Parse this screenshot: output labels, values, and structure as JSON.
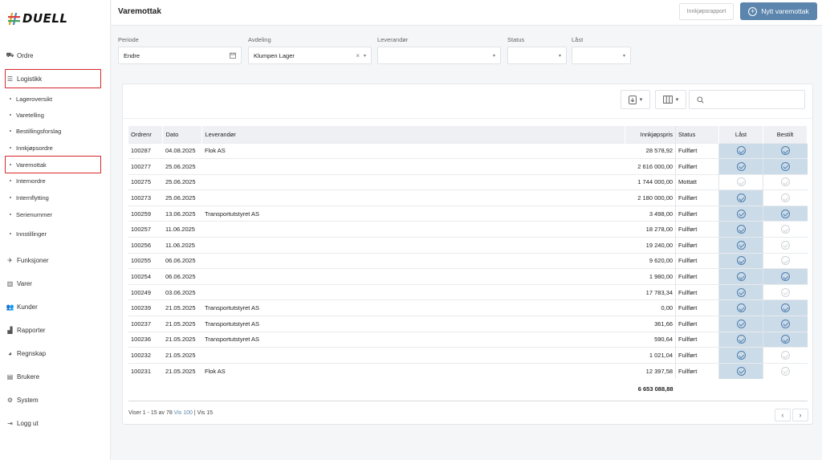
{
  "app": {
    "logo_text": "DUELL"
  },
  "sidebar": {
    "items": [
      {
        "name": "ordre",
        "label": "Ordre",
        "icon": "truck-icon"
      },
      {
        "name": "logistikk",
        "label": "Logistikk",
        "icon": "list-icon"
      },
      {
        "name": "funksjoner",
        "label": "Funksjoner",
        "icon": "rocket-icon"
      },
      {
        "name": "varer",
        "label": "Varer",
        "icon": "barcode-icon"
      },
      {
        "name": "kunder",
        "label": "Kunder",
        "icon": "users-icon"
      },
      {
        "name": "rapporter",
        "label": "Rapporter",
        "icon": "chart-icon"
      },
      {
        "name": "regnskap",
        "label": "Regnskap",
        "icon": "pie-icon"
      },
      {
        "name": "brukere",
        "label": "Brukere",
        "icon": "id-card-icon"
      },
      {
        "name": "system",
        "label": "System",
        "icon": "cogs-icon"
      },
      {
        "name": "logg-ut",
        "label": "Logg ut",
        "icon": "logout-icon"
      }
    ],
    "sub_items": [
      {
        "name": "lageroversikt",
        "label": "Lageroversikt"
      },
      {
        "name": "varetelling",
        "label": "Varetelling"
      },
      {
        "name": "bestillingsforslag",
        "label": "Bestillingsforslag"
      },
      {
        "name": "innkjopsordre",
        "label": "Innkjøpsordre"
      },
      {
        "name": "varemottak",
        "label": "Varemottak"
      },
      {
        "name": "internordre",
        "label": "Internordre"
      },
      {
        "name": "internflytting",
        "label": "Internflytting"
      },
      {
        "name": "serienummer",
        "label": "Serienummer"
      },
      {
        "name": "innstillinger",
        "label": "Innstillinger"
      }
    ],
    "highlight_color": "#d9252a"
  },
  "header": {
    "title": "Varemottak",
    "report_button": "Innkjøpsrapport",
    "new_button": "Nytt varemottak",
    "accent_color": "#5b85ad"
  },
  "filters": {
    "periode": {
      "label": "Periode",
      "value": "Endre"
    },
    "avdeling": {
      "label": "Avdeling",
      "value": "Klumpen Lager"
    },
    "leverandor": {
      "label": "Leverandør",
      "value": ""
    },
    "status": {
      "label": "Status",
      "value": ""
    },
    "last": {
      "label": "Låst",
      "value": ""
    }
  },
  "table": {
    "headers": {
      "ordrenr": "Ordrenr",
      "dato": "Dato",
      "leverandor": "Leverandør",
      "innkjopspris": "Innkjøpspris",
      "status": "Status",
      "last": "Låst",
      "bestilt": "Bestilt"
    },
    "rows": [
      {
        "ordrenr": "100287",
        "dato": "04.08.2025",
        "leverandor": "Flok AS",
        "innkjopspris": "28 578,92",
        "status": "Fullført",
        "last": true,
        "bestilt": true
      },
      {
        "ordrenr": "100277",
        "dato": "25.06.2025",
        "leverandor": "",
        "innkjopspris": "2 616 000,00",
        "status": "Fullført",
        "last": true,
        "bestilt": true
      },
      {
        "ordrenr": "100275",
        "dato": "25.06.2025",
        "leverandor": "",
        "innkjopspris": "1 744 000,00",
        "status": "Mottatt",
        "last": false,
        "bestilt": false
      },
      {
        "ordrenr": "100273",
        "dato": "25.06.2025",
        "leverandor": "",
        "innkjopspris": "2 180 000,00",
        "status": "Fullført",
        "last": true,
        "bestilt": false
      },
      {
        "ordrenr": "100259",
        "dato": "13.06.2025",
        "leverandor": "Transportutstyret AS",
        "innkjopspris": "3 498,00",
        "status": "Fullført",
        "last": true,
        "bestilt": true
      },
      {
        "ordrenr": "100257",
        "dato": "11.06.2025",
        "leverandor": "",
        "innkjopspris": "18 278,00",
        "status": "Fullført",
        "last": true,
        "bestilt": false
      },
      {
        "ordrenr": "100256",
        "dato": "11.06.2025",
        "leverandor": "",
        "innkjopspris": "19 240,00",
        "status": "Fullført",
        "last": true,
        "bestilt": false
      },
      {
        "ordrenr": "100255",
        "dato": "06.06.2025",
        "leverandor": "",
        "innkjopspris": "9 620,00",
        "status": "Fullført",
        "last": true,
        "bestilt": false
      },
      {
        "ordrenr": "100254",
        "dato": "06.06.2025",
        "leverandor": "",
        "innkjopspris": "1 980,00",
        "status": "Fullført",
        "last": true,
        "bestilt": true
      },
      {
        "ordrenr": "100249",
        "dato": "03.06.2025",
        "leverandor": "",
        "innkjopspris": "17 783,34",
        "status": "Fullført",
        "last": true,
        "bestilt": false
      },
      {
        "ordrenr": "100239",
        "dato": "21.05.2025",
        "leverandor": "Transportutstyret AS",
        "innkjopspris": "0,00",
        "status": "Fullført",
        "last": true,
        "bestilt": true
      },
      {
        "ordrenr": "100237",
        "dato": "21.05.2025",
        "leverandor": "Transportutstyret AS",
        "innkjopspris": "361,66",
        "status": "Fullført",
        "last": true,
        "bestilt": true
      },
      {
        "ordrenr": "100236",
        "dato": "21.05.2025",
        "leverandor": "Transportutstyret AS",
        "innkjopspris": "590,64",
        "status": "Fullført",
        "last": true,
        "bestilt": true
      },
      {
        "ordrenr": "100232",
        "dato": "21.05.2025",
        "leverandor": "",
        "innkjopspris": "1 021,04",
        "status": "Fullført",
        "last": true,
        "bestilt": false
      },
      {
        "ordrenr": "100231",
        "dato": "21.05.2025",
        "leverandor": "Flok AS",
        "innkjopspris": "12 397,58",
        "status": "Fullført",
        "last": true,
        "bestilt": false
      }
    ],
    "total": "6 653 088,88"
  },
  "footer": {
    "showing": "Viser 1 - 15 av 78",
    "show_100": "Vis 100",
    "divider": "|",
    "show_15": "Vis 15"
  }
}
